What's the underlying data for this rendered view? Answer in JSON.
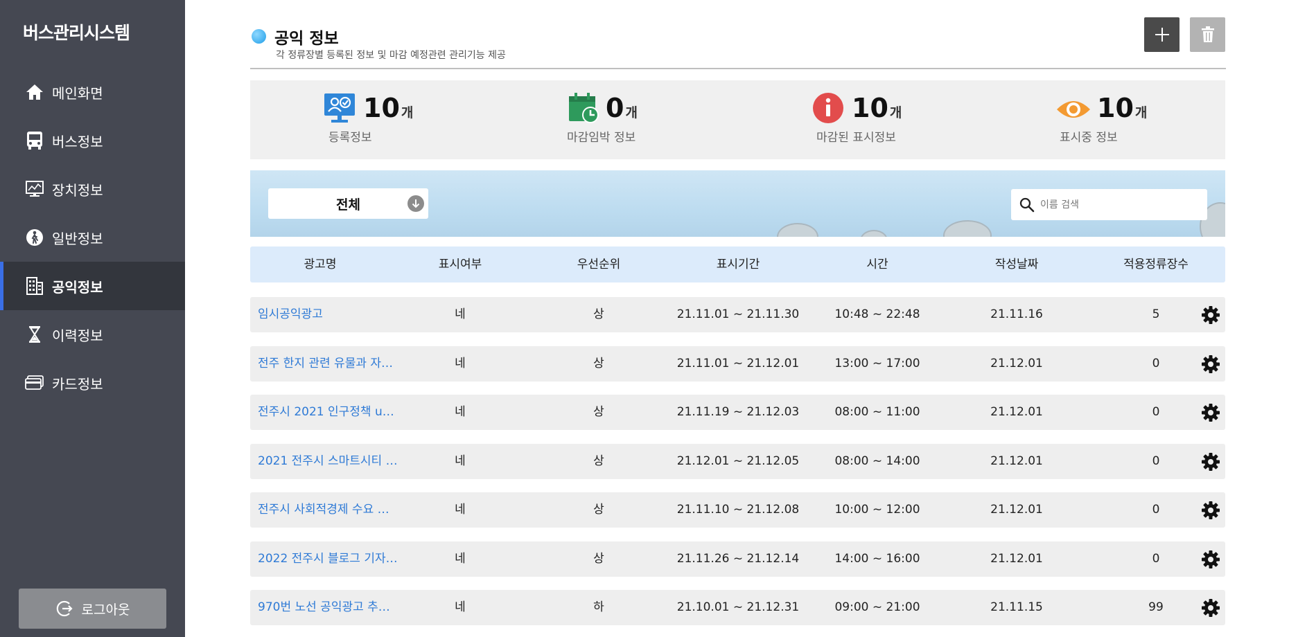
{
  "app": {
    "brand": "버스관리시스템"
  },
  "sidebar": {
    "items": [
      {
        "label": "메인화면",
        "icon": "home-icon"
      },
      {
        "label": "버스정보",
        "icon": "bus-icon"
      },
      {
        "label": "장치정보",
        "icon": "monitor-icon"
      },
      {
        "label": "일반정보",
        "icon": "person-walk-icon"
      },
      {
        "label": "공익정보",
        "icon": "building-icon",
        "active": true
      },
      {
        "label": "이력정보",
        "icon": "hourglass-icon"
      },
      {
        "label": "카드정보",
        "icon": "card-icon"
      }
    ],
    "logout_label": "로그아웃"
  },
  "header": {
    "title": "공익 정보",
    "subtitle": "각 정류장별 등록된 정보 및 마감 예정관련 관리기능 제공"
  },
  "stats": [
    {
      "value": "10",
      "unit": "개",
      "label": "등록정보",
      "icon": "registered-monitor-icon",
      "color": "#2f86d8"
    },
    {
      "value": "0",
      "unit": "개",
      "label": "마감임박 정보",
      "icon": "calendar-clock-icon",
      "color": "#2e9a5c"
    },
    {
      "value": "10",
      "unit": "개",
      "label": "마감된 표시정보",
      "icon": "info-icon",
      "color": "#e24c4c"
    },
    {
      "value": "10",
      "unit": "개",
      "label": "표시중 정보",
      "icon": "eye-icon",
      "color": "#f39a32"
    }
  ],
  "filter": {
    "selected": "전체",
    "search_placeholder": "이름 검색"
  },
  "table": {
    "columns": [
      "광고명",
      "표시여부",
      "우선순위",
      "표시기간",
      "시간",
      "작성날짜",
      "적용정류장수"
    ],
    "rows": [
      [
        "임시공익광고",
        "네",
        "상",
        "21.11.01 ~ 21.11.30",
        "10:48 ~ 22:48",
        "21.11.16",
        "5"
      ],
      [
        "전주 한지 관련 유물과 자…",
        "네",
        "상",
        "21.11.01 ~ 21.12.01",
        "13:00 ~ 17:00",
        "21.12.01",
        "0"
      ],
      [
        "전주시 2021 인구정책 u…",
        "네",
        "상",
        "21.11.19 ~ 21.12.03",
        "08:00 ~ 11:00",
        "21.12.01",
        "0"
      ],
      [
        "2021 전주시 스마트시티 …",
        "네",
        "상",
        "21.12.01 ~ 21.12.05",
        "08:00 ~ 14:00",
        "21.12.01",
        "0"
      ],
      [
        "전주시 사회적경제 수요 …",
        "네",
        "상",
        "21.11.10 ~ 21.12.08",
        "10:00 ~ 12:00",
        "21.12.01",
        "0"
      ],
      [
        "2022 전주시 블로그 기자…",
        "네",
        "상",
        "21.11.26 ~ 21.12.14",
        "14:00 ~ 16:00",
        "21.12.01",
        "0"
      ],
      [
        "970번 노선 공익광고 추…",
        "네",
        "하",
        "21.10.01 ~ 21.12.31",
        "09:00 ~ 21:00",
        "21.11.15",
        "99"
      ]
    ]
  },
  "colors": {
    "sidebar_bg": "#454852",
    "active_accent": "#3a6fe6",
    "link": "#2e7ad6",
    "table_header_bg": "#dcebfb"
  }
}
